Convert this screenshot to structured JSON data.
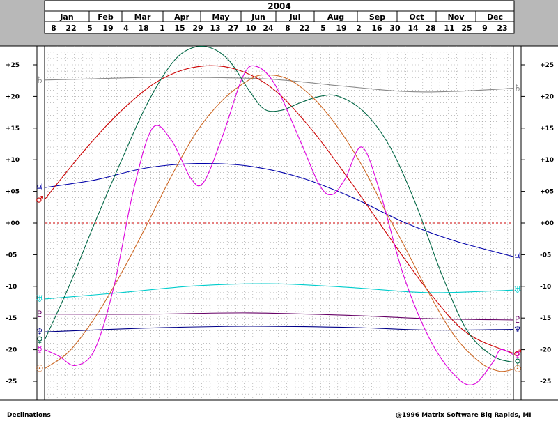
{
  "chart_data": {
    "type": "line",
    "title": "2004",
    "months": [
      "Jan",
      "Feb",
      "Mar",
      "Apr",
      "May",
      "Jun",
      "Jul",
      "Aug",
      "Sep",
      "Oct",
      "Nov",
      "Dec"
    ],
    "day_ticks": [
      "8",
      "22",
      "5",
      "19",
      "4",
      "18",
      "1",
      "15",
      "29",
      "13",
      "27",
      "10",
      "24",
      "8",
      "22",
      "5",
      "19",
      "2",
      "16",
      "30",
      "14",
      "28",
      "11",
      "25",
      "9",
      "23"
    ],
    "y_ticks": [
      "+25",
      "+20",
      "+15",
      "+10",
      "+05",
      "+00",
      "-05",
      "-10",
      "-15",
      "-20",
      "-25"
    ],
    "ylim": [
      -28,
      28
    ],
    "x_unit": "day of year 2004",
    "xlim": [
      1,
      366
    ],
    "series": [
      {
        "glyph": "♄",
        "color": "#8a8a8a",
        "points": [
          [
            1,
            22.6
          ],
          [
            40,
            22.8
          ],
          [
            80,
            23.0
          ],
          [
            130,
            23.0
          ],
          [
            180,
            22.7
          ],
          [
            230,
            21.7
          ],
          [
            280,
            20.8
          ],
          [
            320,
            20.8
          ],
          [
            366,
            21.3
          ]
        ]
      },
      {
        "glyph": "♃",
        "color": "#0000aa",
        "points": [
          [
            1,
            5.6
          ],
          [
            40,
            6.8
          ],
          [
            80,
            8.7
          ],
          [
            120,
            9.4
          ],
          [
            160,
            9.0
          ],
          [
            200,
            7.2
          ],
          [
            240,
            4.1
          ],
          [
            280,
            0.2
          ],
          [
            320,
            -2.8
          ],
          [
            366,
            -5.3
          ]
        ]
      },
      {
        "glyph": "♂",
        "color": "#cc0000",
        "points": [
          [
            1,
            3.7
          ],
          [
            30,
            11.0
          ],
          [
            60,
            17.6
          ],
          [
            90,
            22.5
          ],
          [
            120,
            24.7
          ],
          [
            150,
            24.3
          ],
          [
            180,
            21.0
          ],
          [
            210,
            14.5
          ],
          [
            240,
            6.3
          ],
          [
            270,
            -2.4
          ],
          [
            300,
            -10.8
          ],
          [
            330,
            -17.4
          ],
          [
            366,
            -20.6
          ]
        ]
      },
      {
        "glyph": "♅",
        "color": "#00cccc",
        "points": [
          [
            1,
            -12.0
          ],
          [
            60,
            -11.0
          ],
          [
            120,
            -9.9
          ],
          [
            180,
            -9.6
          ],
          [
            240,
            -10.2
          ],
          [
            300,
            -11.0
          ],
          [
            366,
            -10.6
          ]
        ]
      },
      {
        "glyph": "♇",
        "color": "#660066",
        "points": [
          [
            1,
            -14.4
          ],
          [
            80,
            -14.4
          ],
          [
            160,
            -14.2
          ],
          [
            240,
            -14.6
          ],
          [
            300,
            -15.1
          ],
          [
            366,
            -15.3
          ]
        ]
      },
      {
        "glyph": "♆",
        "color": "#000088",
        "points": [
          [
            1,
            -17.2
          ],
          [
            80,
            -16.6
          ],
          [
            160,
            -16.3
          ],
          [
            240,
            -16.5
          ],
          [
            300,
            -16.9
          ],
          [
            366,
            -16.8
          ]
        ]
      },
      {
        "glyph": "♀",
        "color": "#006644",
        "points": [
          [
            1,
            -18.5
          ],
          [
            20,
            -10.0
          ],
          [
            40,
            0.0
          ],
          [
            60,
            9.5
          ],
          [
            80,
            18.5
          ],
          [
            100,
            25.2
          ],
          [
            115,
            27.6
          ],
          [
            130,
            27.7
          ],
          [
            145,
            25.6
          ],
          [
            160,
            21.0
          ],
          [
            172,
            18.0
          ],
          [
            185,
            17.8
          ],
          [
            200,
            19.0
          ],
          [
            215,
            20.0
          ],
          [
            230,
            20.0
          ],
          [
            250,
            17.5
          ],
          [
            270,
            12.0
          ],
          [
            290,
            3.0
          ],
          [
            310,
            -8.0
          ],
          [
            330,
            -17.0
          ],
          [
            350,
            -21.0
          ],
          [
            366,
            -22.0
          ]
        ]
      },
      {
        "glyph": "☉",
        "color": "#cc6622",
        "points": [
          [
            1,
            -23.0
          ],
          [
            20,
            -20.3
          ],
          [
            40,
            -15.0
          ],
          [
            60,
            -8.2
          ],
          [
            80,
            -0.5
          ],
          [
            100,
            7.5
          ],
          [
            120,
            14.6
          ],
          [
            140,
            19.5
          ],
          [
            160,
            22.6
          ],
          [
            172,
            23.4
          ],
          [
            190,
            22.8
          ],
          [
            210,
            19.8
          ],
          [
            230,
            14.9
          ],
          [
            250,
            8.4
          ],
          [
            266,
            2.0
          ],
          [
            280,
            -3.2
          ],
          [
            300,
            -11.0
          ],
          [
            320,
            -17.8
          ],
          [
            340,
            -22.0
          ],
          [
            355,
            -23.4
          ],
          [
            366,
            -23.1
          ]
        ]
      },
      {
        "glyph": "☿",
        "color": "#dd00dd",
        "points": [
          [
            1,
            -20.0
          ],
          [
            12,
            -21.0
          ],
          [
            25,
            -22.5
          ],
          [
            40,
            -20.0
          ],
          [
            55,
            -10.0
          ],
          [
            70,
            5.0
          ],
          [
            85,
            15.0
          ],
          [
            100,
            13.0
          ],
          [
            115,
            7.0
          ],
          [
            125,
            6.5
          ],
          [
            140,
            14.0
          ],
          [
            155,
            23.0
          ],
          [
            165,
            24.8
          ],
          [
            180,
            22.0
          ],
          [
            200,
            13.0
          ],
          [
            215,
            6.0
          ],
          [
            225,
            4.5
          ],
          [
            235,
            7.0
          ],
          [
            248,
            12.0
          ],
          [
            262,
            5.0
          ],
          [
            280,
            -8.0
          ],
          [
            300,
            -18.0
          ],
          [
            320,
            -24.0
          ],
          [
            335,
            -25.5
          ],
          [
            350,
            -22.0
          ],
          [
            356,
            -20.0
          ],
          [
            366,
            -20.8
          ]
        ]
      }
    ]
  },
  "footer": {
    "left": "Declinations",
    "right": "@1996  Matrix  Software    Big  Rapids,  MI"
  }
}
